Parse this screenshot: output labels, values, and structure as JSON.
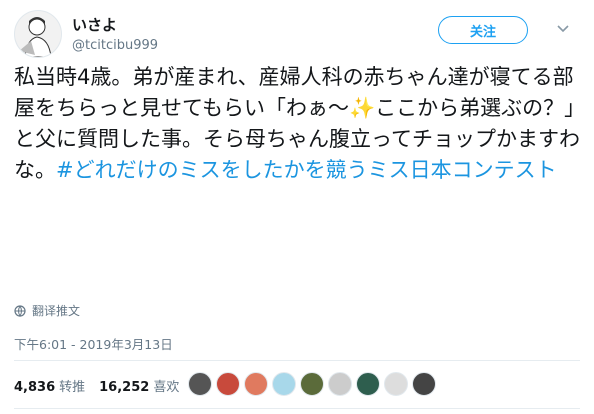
{
  "author": {
    "name": "いさよ",
    "handle": "@tcitcibu999"
  },
  "follow_label": "关注",
  "tweet": {
    "text": "私当時4歳。弟が産まれ、産婦人科の赤ちゃん達が寝てる部屋をちらっと見せてもらい「わぁ〜✨ここから弟選ぶの？」と父に質問した事。そら母ちゃん腹立ってチョップかますわな。",
    "hashtag": "#どれだけのミスをしたかを競うミス日本コンテスト"
  },
  "translate_label": "翻译推文",
  "timestamp": "下午6:01 - 2019年3月13日",
  "stats": {
    "retweets_count": "4,836",
    "retweets_label": "转推",
    "likes_count": "16,252",
    "likes_label": "喜欢"
  },
  "likers": [
    "#555555",
    "#c84a3c",
    "#e07a5f",
    "#a8d8ea",
    "#5b6b3a",
    "#cccccc",
    "#2e5e4e",
    "#dddddd",
    "#444444"
  ],
  "icons": {
    "caret": "chevron-down-icon",
    "translate": "globe-icon"
  },
  "colors": {
    "accent": "#1da1f2",
    "hashtag": "#1b95e0",
    "muted": "#657786"
  }
}
